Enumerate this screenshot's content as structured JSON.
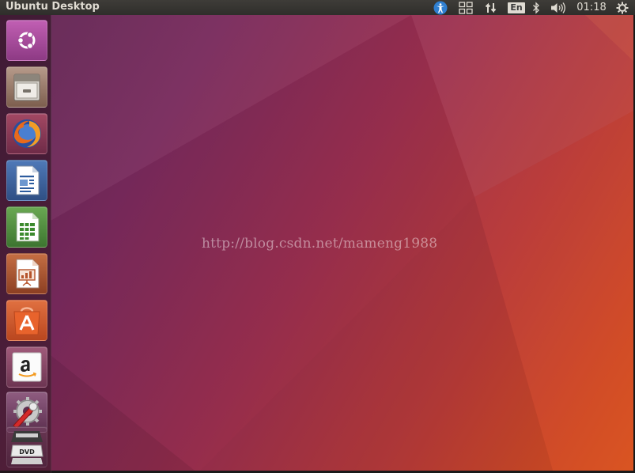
{
  "top_panel": {
    "window_title": "Ubuntu Desktop",
    "keyboard_layout": "En",
    "clock": "01:18",
    "icons": [
      "accessibility-icon",
      "workspace-switcher-icon",
      "network-icon",
      "bluetooth-icon",
      "volume-icon",
      "session-gear-icon"
    ]
  },
  "desktop": {
    "watermark_text": "http://blog.csdn.net/mameng1988"
  },
  "launcher": {
    "items": [
      {
        "name": "dash-home",
        "icon": "ubuntu-logo-icon",
        "color": "#a24b98"
      },
      {
        "name": "files",
        "icon": "file-cabinet-icon",
        "color": "#8a6b5a"
      },
      {
        "name": "firefox",
        "icon": "firefox-icon",
        "color": "#8c3a52"
      },
      {
        "name": "libreoffice-writer",
        "icon": "writer-document-icon",
        "color": "#3b5f9a"
      },
      {
        "name": "libreoffice-calc",
        "icon": "calc-spreadsheet-icon",
        "color": "#4d8a3a"
      },
      {
        "name": "libreoffice-impress",
        "icon": "impress-presentation-icon",
        "color": "#a8552f"
      },
      {
        "name": "ubuntu-software",
        "icon": "software-bag-icon",
        "color": "#d5562b"
      },
      {
        "name": "amazon",
        "icon": "amazon-icon",
        "color": "#8a4766"
      },
      {
        "name": "system-settings",
        "icon": "settings-wrench-icon",
        "color": "#7a4a6a"
      },
      {
        "name": "dvd-drive",
        "icon": "dvd-icon",
        "color": "#6a3a5a"
      }
    ]
  },
  "colors": {
    "panel_bg": "#3a3834",
    "panel_text": "#dfdbd2",
    "desktop_start": "#5e2452",
    "desktop_end": "#d8531f"
  }
}
